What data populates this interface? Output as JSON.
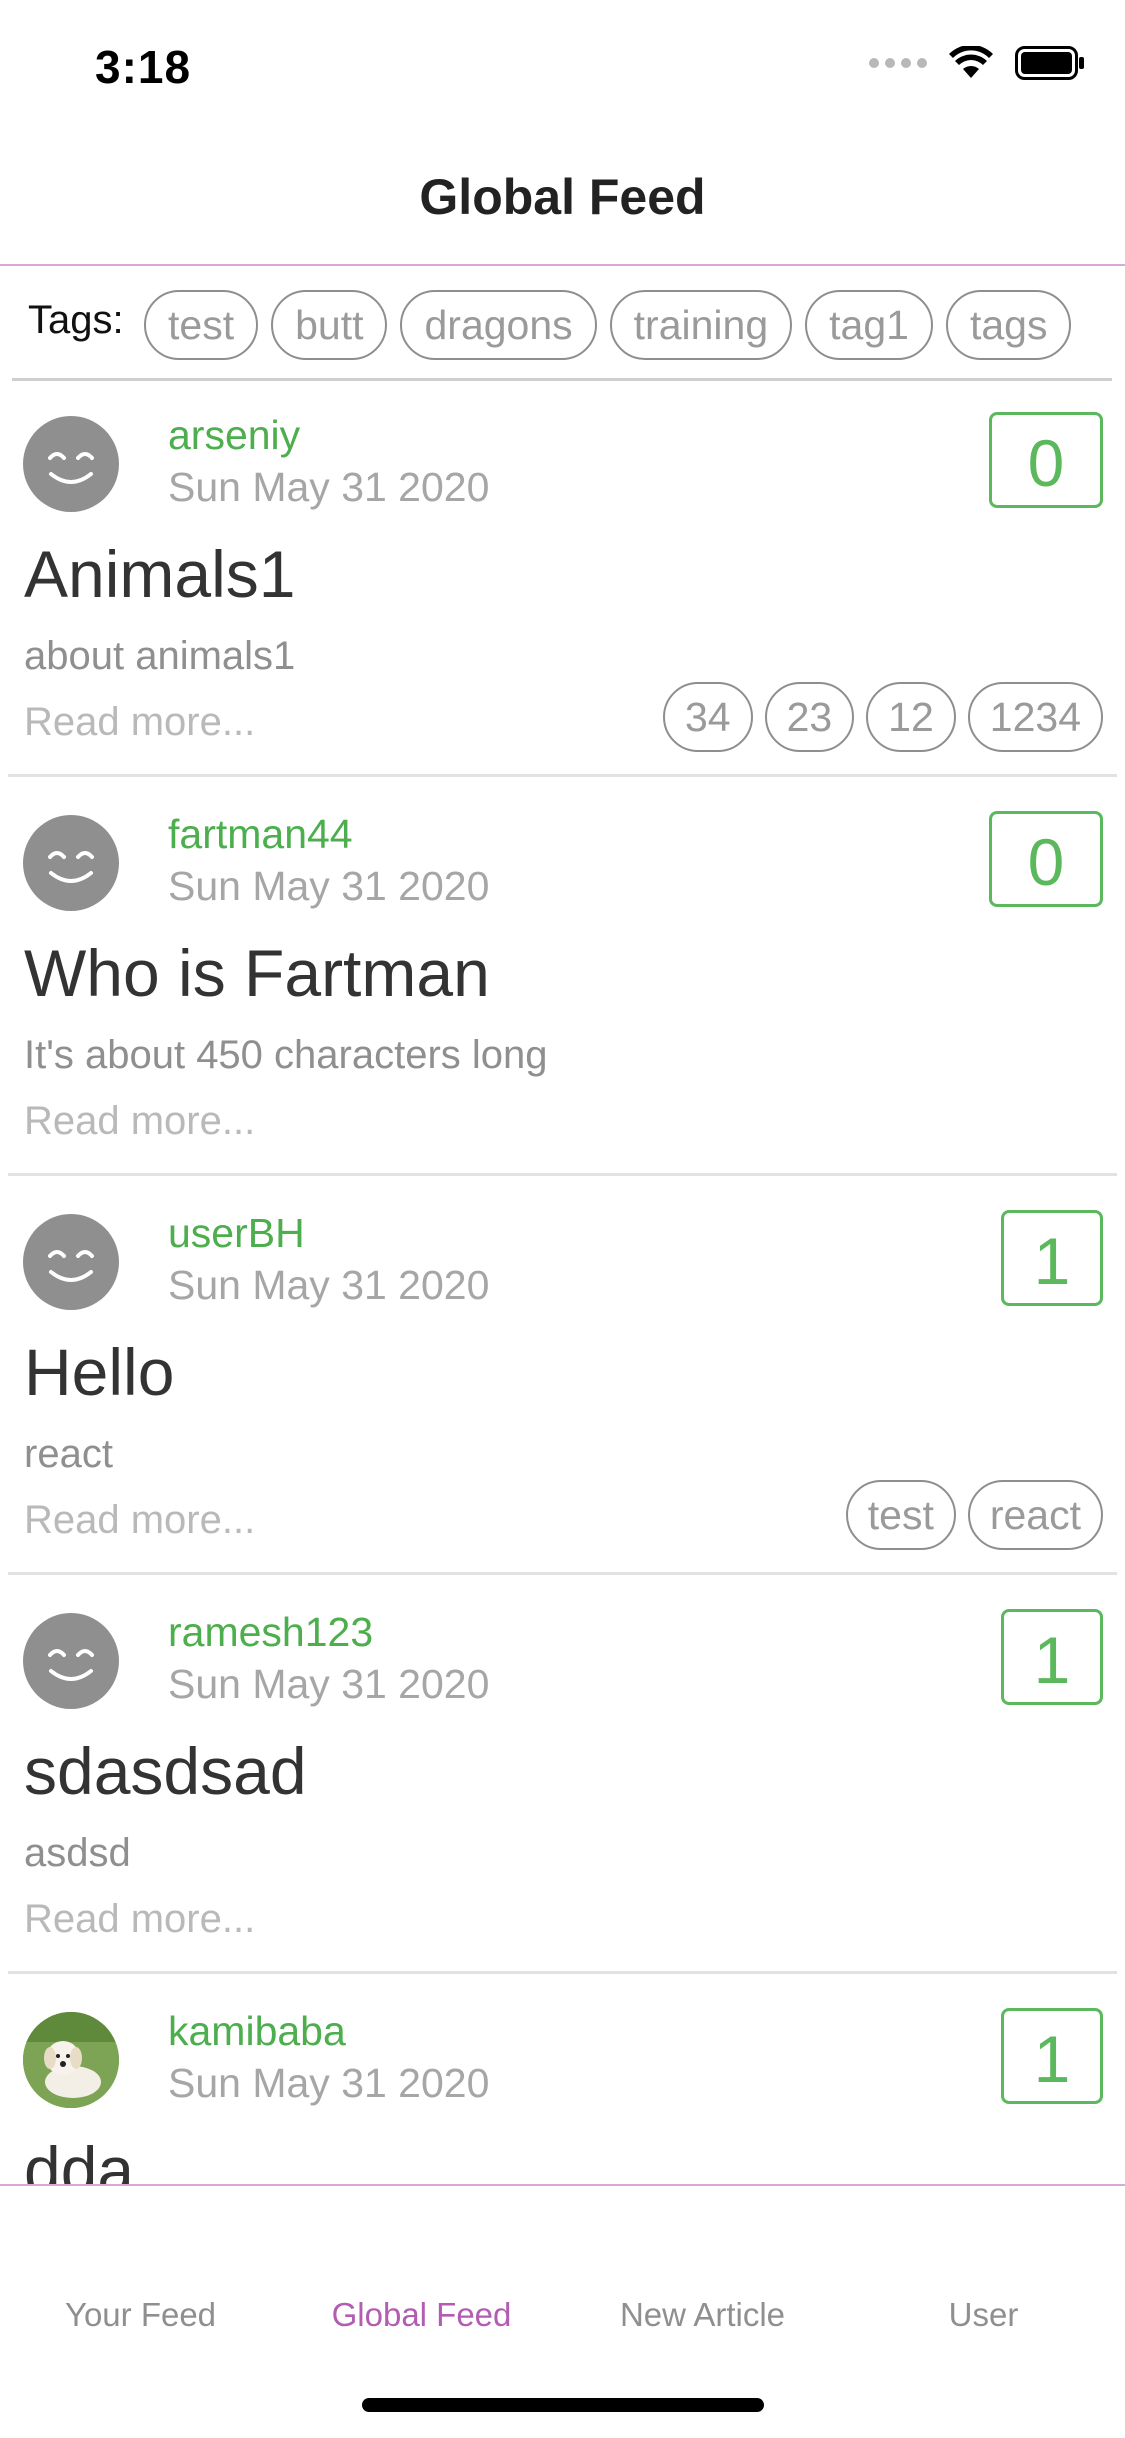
{
  "status": {
    "time": "3:18"
  },
  "header": {
    "title": "Global Feed"
  },
  "tags_bar": {
    "label": "Tags:",
    "tags": [
      "test",
      "butt",
      "dragons",
      "training",
      "tag1",
      "tags"
    ]
  },
  "articles": [
    {
      "author": "arseniy",
      "date": "Sun May 31 2020",
      "favorites": "0",
      "title": "Animals1",
      "description": "about animals1",
      "read_more": "Read more...",
      "tags": [
        "34",
        "23",
        "12",
        "1234"
      ],
      "avatar": "smiley-avatar"
    },
    {
      "author": "fartman44",
      "date": "Sun May 31 2020",
      "favorites": "0",
      "title": "Who is Fartman",
      "description": "It's about 450 characters long",
      "read_more": "Read more...",
      "tags": [],
      "avatar": "smiley-avatar"
    },
    {
      "author": "userBH",
      "date": "Sun May 31 2020",
      "favorites": "1",
      "title": "Hello",
      "description": "react",
      "read_more": "Read more...",
      "tags": [
        "test",
        "react"
      ],
      "avatar": "smiley-avatar"
    },
    {
      "author": "ramesh123",
      "date": "Sun May 31 2020",
      "favorites": "1",
      "title": "sdasdsad",
      "description": "asdsd",
      "read_more": "Read more...",
      "tags": [],
      "avatar": "smiley-avatar"
    },
    {
      "author": "kamibaba",
      "date": "Sun May 31 2020",
      "favorites": "1",
      "title": "dda",
      "description": "",
      "read_more": "",
      "tags": [],
      "avatar": "puppy-photo-avatar"
    }
  ],
  "tabs": [
    {
      "label": "Your Feed",
      "active": false
    },
    {
      "label": "Global Feed",
      "active": true
    },
    {
      "label": "New Article",
      "active": false
    },
    {
      "label": "User",
      "active": false
    }
  ],
  "colors": {
    "accent": "#b25cb2",
    "green": "#5cb85c",
    "divider": "#d9a8d9"
  }
}
